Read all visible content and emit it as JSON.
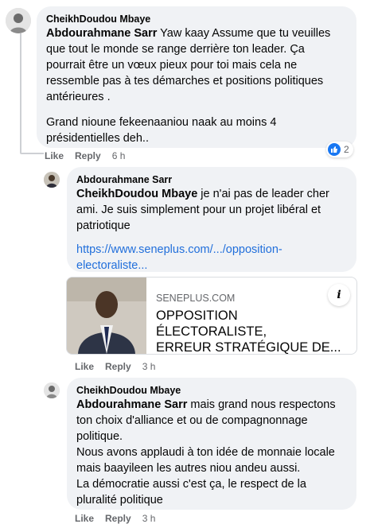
{
  "comments": [
    {
      "author": "CheikhDoudou Mbaye",
      "mention": "Abdourahmane Sarr",
      "text_lines": [
        " Yaw kaay Assume que tu veuilles",
        "que tout le monde se range derrière ton leader. Ça",
        "pourrait être un vœux pieux pour toi mais cela ne",
        "ressemble pas à tes démarches et positions politiques",
        "antérieures ."
      ],
      "text2_lines": [
        "Grand nioune fekeenaaniou naak au moins 4",
        "présidentielles deh.."
      ],
      "like_label": "Like",
      "reply_label": "Reply",
      "time": "6 h",
      "reaction_count": "2"
    },
    {
      "author": "Abdourahmane Sarr",
      "mention": "CheikhDoudou Mbaye",
      "text_lines": [
        " je n'ai pas de leader cher",
        "ami. Je suis simplement pour un projet libéral et",
        "patriotique"
      ],
      "link_lines": [
        "https://www.seneplus.com/.../opposition-",
        "electoraliste..."
      ],
      "card": {
        "domain": "SENEPLUS.COM",
        "title_lines": [
          "OPPOSITION ÉLECTORALISTE,",
          "ERREUR STRATÉGIQUE DE..."
        ],
        "info": "i"
      },
      "like_label": "Like",
      "reply_label": "Reply",
      "time": "3 h"
    },
    {
      "author": "CheikhDoudou Mbaye",
      "mention": "Abdourahmane Sarr",
      "text_lines": [
        " mais grand nous respectons",
        "ton choix d'alliance et ou de compagnonnage",
        "politique.",
        "Nous avons applaudi à ton idée de monnaie locale",
        "mais baayileen les autres niou andeu aussi.",
        "La démocratie aussi c'est ça, le respect de la",
        "pluralité politique"
      ],
      "like_label": "Like",
      "reply_label": "Reply",
      "time": "3 h"
    }
  ],
  "colors": {
    "bubble": "#f0f2f5",
    "link": "#216fdb",
    "meta": "#65676b",
    "like_blue": "#1877f2"
  }
}
